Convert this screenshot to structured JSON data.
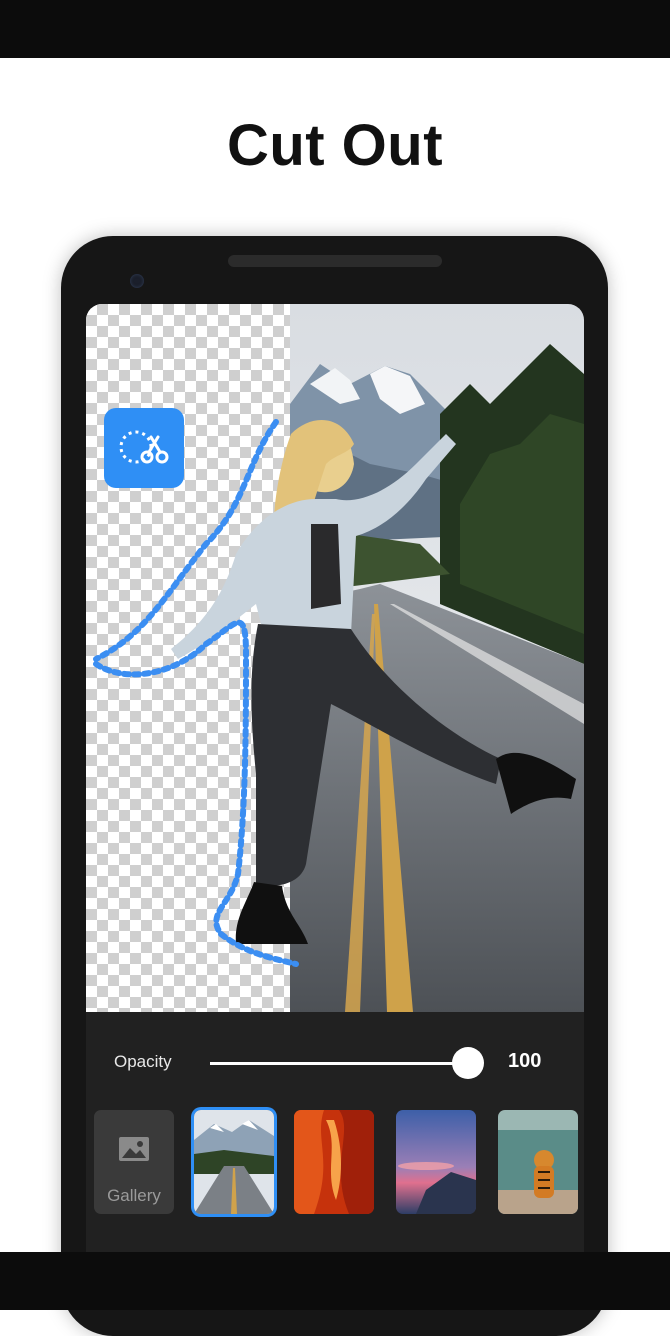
{
  "headline": "Cut Out",
  "editor": {
    "opacity_label": "Opacity",
    "opacity_value": "100",
    "opacity_level": 1.0,
    "gallery_label": "Gallery",
    "backgrounds": [
      {
        "name": "mountain-road",
        "selected": true
      },
      {
        "name": "red-canyon",
        "selected": false
      },
      {
        "name": "sunset-sky",
        "selected": false
      },
      {
        "name": "tiger-water",
        "selected": false
      }
    ]
  },
  "colors": {
    "accent": "#2f8ff5",
    "frame": "#161616",
    "panel": "#212121"
  }
}
